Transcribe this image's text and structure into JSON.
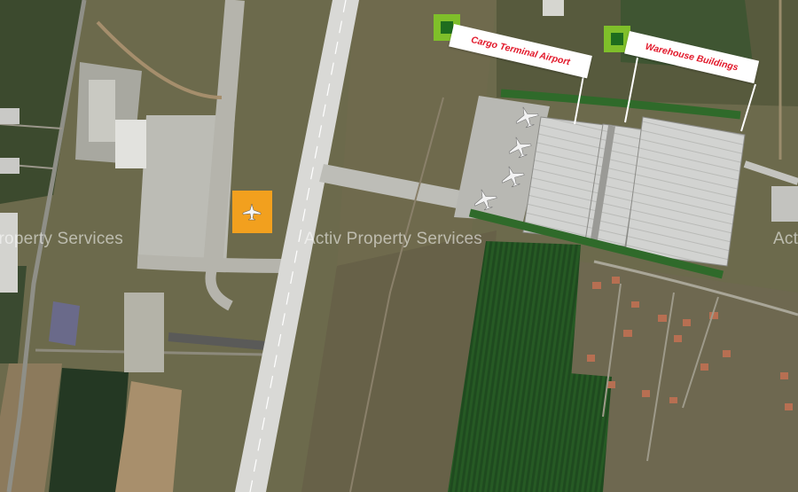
{
  "watermark": "Activ Property Services",
  "labels": {
    "cargo_terminal": "Cargo Terminal Airport",
    "warehouse_buildings": "Warehouse Buildings"
  },
  "icons": {
    "label_marker": "green-square-marker",
    "aircraft": "airplane-icon",
    "highlight_pad": "orange-square"
  },
  "colors": {
    "label_text": "#e2182a",
    "label_bg": "#ffffff",
    "marker_outer": "#7fbf2a",
    "marker_inner": "#1e6d1e",
    "highlight_pad": "#f2a01e",
    "runway": "#d9d9d6"
  }
}
